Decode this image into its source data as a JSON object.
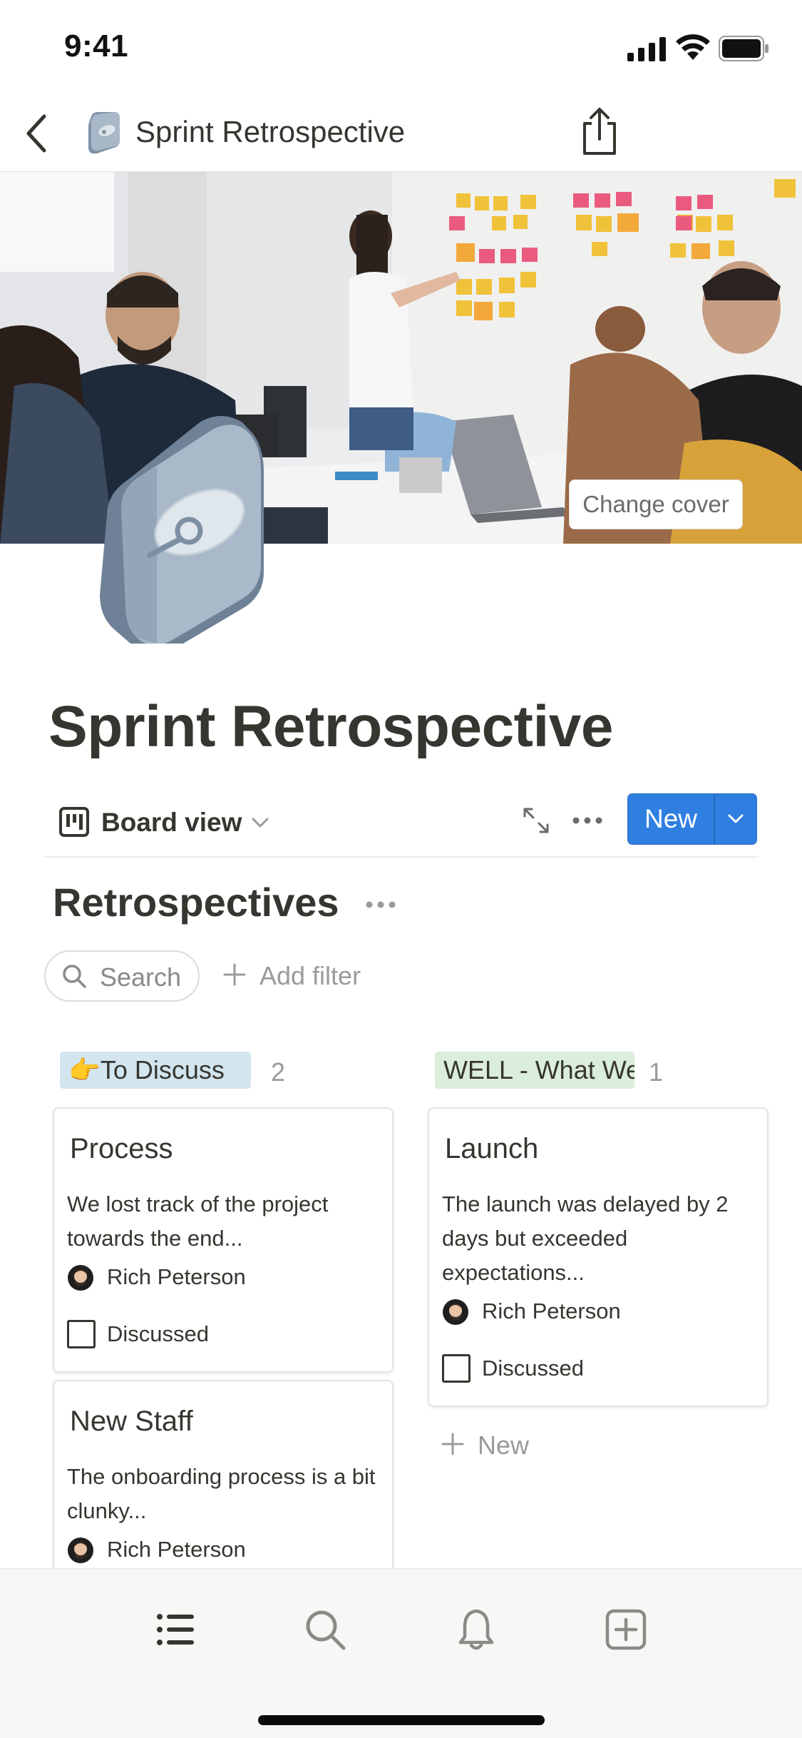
{
  "status_bar": {
    "time": "9:41"
  },
  "nav": {
    "title": "Sprint Retrospective"
  },
  "cover": {
    "change_cover_label": "Change cover"
  },
  "page": {
    "title": "Sprint Retrospective"
  },
  "view_bar": {
    "view_label": "Board view",
    "new_label": "New"
  },
  "database": {
    "title": "Retrospectives",
    "search_label": "Search",
    "add_filter_label": "Add filter"
  },
  "board": {
    "groups": [
      {
        "label": "👉To Discuss",
        "count": "2",
        "color": "#d3e5ef",
        "cards": [
          {
            "title": "Process",
            "body": "We lost track of the project towards the end...",
            "person": "Rich Peterson",
            "checkbox_label": "Discussed",
            "checked": false
          },
          {
            "title": "New Staff",
            "body": "The onboarding process is a bit clunky...",
            "person": "Rich Peterson"
          }
        ]
      },
      {
        "label": "WELL - What Went Well",
        "count": "1",
        "color": "#dbeddb",
        "cards": [
          {
            "title": "Launch",
            "body": "The launch was delayed by 2 days but exceeded expectations...",
            "person": "Rich Peterson",
            "checkbox_label": "Discussed",
            "checked": false
          }
        ],
        "new_label": "New"
      }
    ]
  },
  "tab_bar": {
    "items": [
      {
        "icon": "list-icon"
      },
      {
        "icon": "search-icon"
      },
      {
        "icon": "bell-icon"
      },
      {
        "icon": "add-page-icon"
      }
    ]
  },
  "colors": {
    "accent": "#2f7fe0",
    "text": "#37352f",
    "muted": "#9b9a97"
  }
}
